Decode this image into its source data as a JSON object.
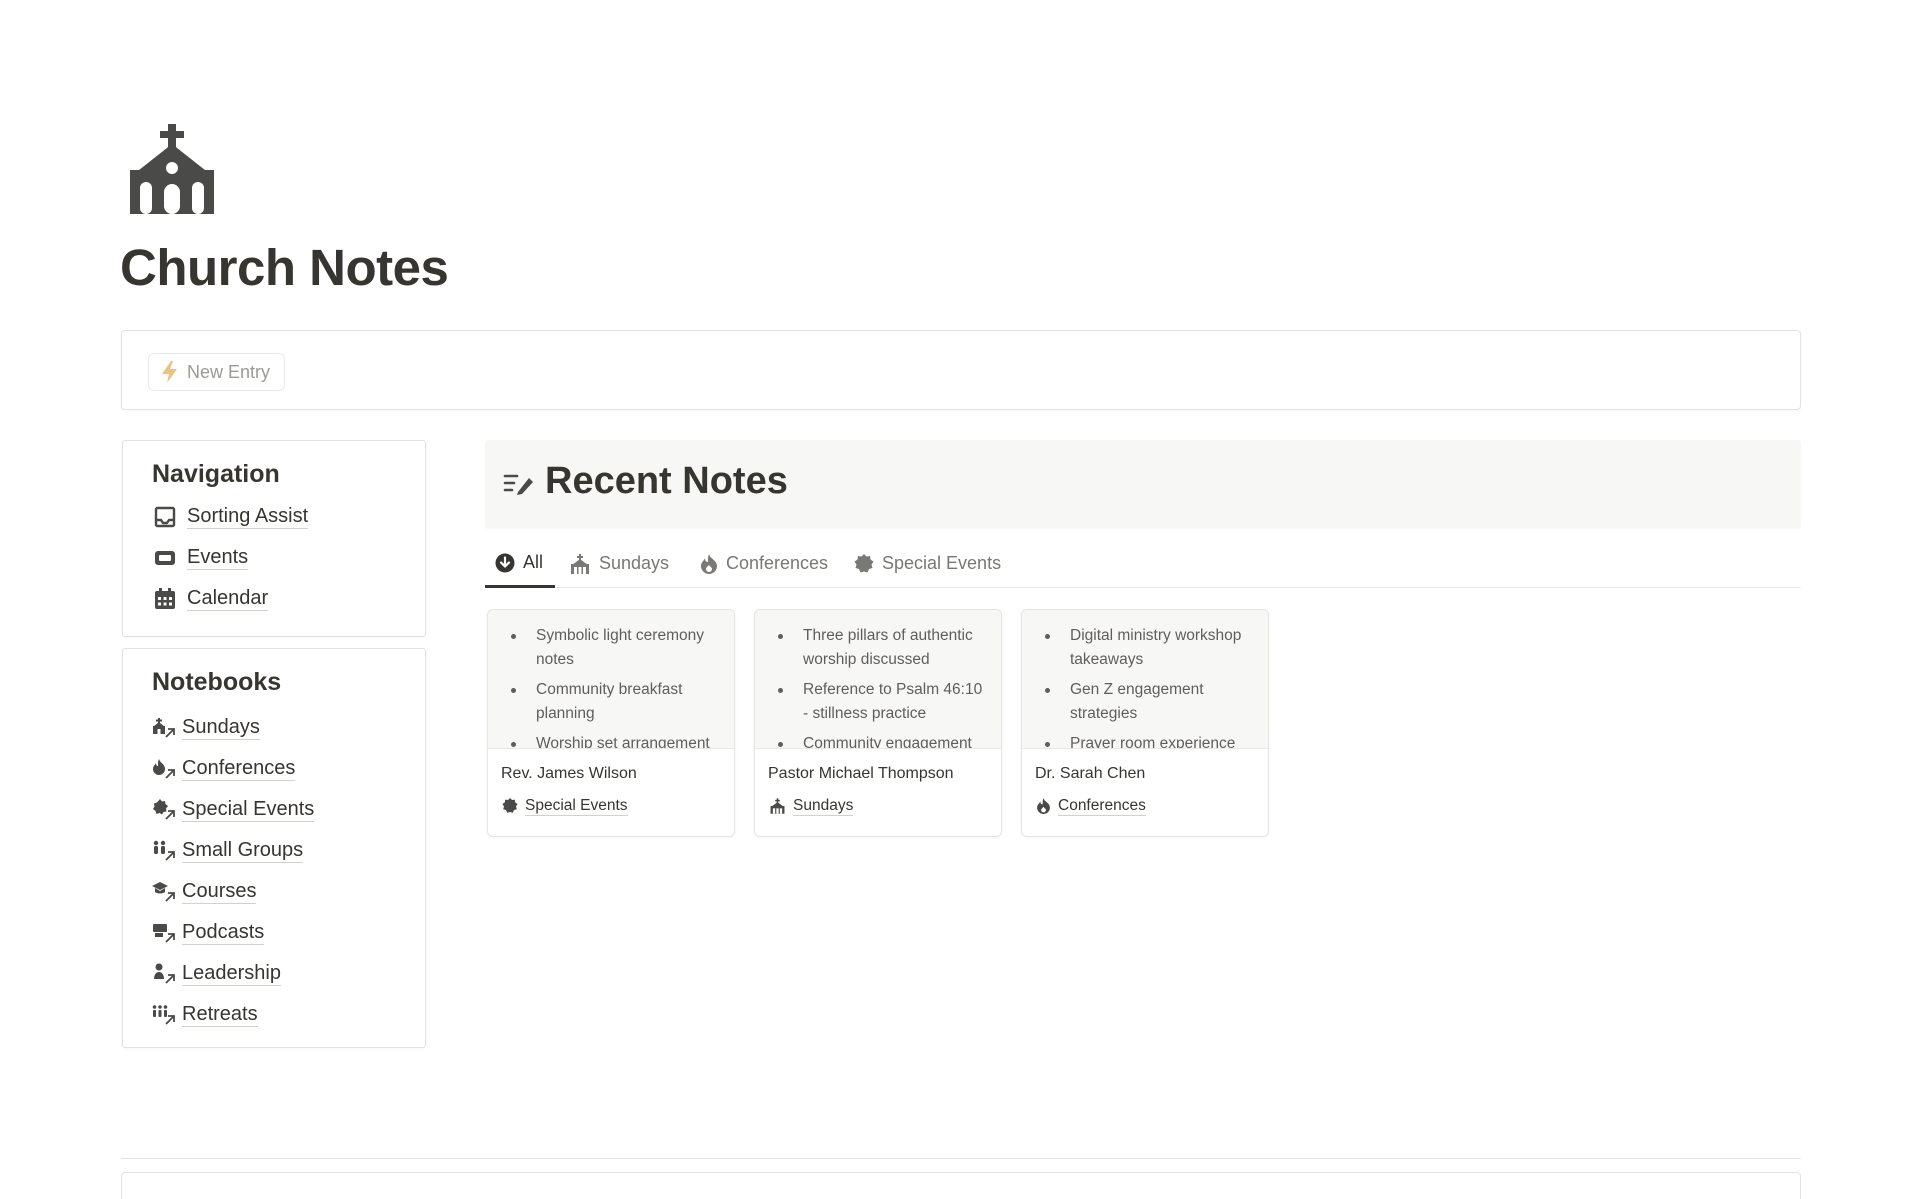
{
  "page": {
    "title": "Church Notes",
    "icon": "church-icon"
  },
  "entry_bar": {
    "new_entry_label": "New Entry",
    "icon": "lightning-icon"
  },
  "navigation": {
    "heading": "Navigation",
    "items": [
      {
        "label": "Sorting Assist",
        "icon": "inbox-icon"
      },
      {
        "label": "Events",
        "icon": "ticket-icon"
      },
      {
        "label": "Calendar",
        "icon": "calendar-icon"
      }
    ]
  },
  "notebooks": {
    "heading": "Notebooks",
    "items": [
      {
        "label": "Sundays",
        "icon": "church-link-icon"
      },
      {
        "label": "Conferences",
        "icon": "flame-link-icon"
      },
      {
        "label": "Special Events",
        "icon": "badge-link-icon"
      },
      {
        "label": "Small Groups",
        "icon": "people-link-icon"
      },
      {
        "label": "Courses",
        "icon": "graduation-link-icon"
      },
      {
        "label": "Podcasts",
        "icon": "microphone-link-icon"
      },
      {
        "label": "Leadership",
        "icon": "person-link-icon"
      },
      {
        "label": "Retreats",
        "icon": "group-link-icon"
      }
    ]
  },
  "recent_notes": {
    "heading": "Recent Notes",
    "tabs": [
      {
        "label": "All",
        "icon": "arrow-down-circle-icon",
        "active": true
      },
      {
        "label": "Sundays",
        "icon": "church-icon",
        "active": false
      },
      {
        "label": "Conferences",
        "icon": "flame-icon",
        "active": false
      },
      {
        "label": "Special Events",
        "icon": "badge-icon",
        "active": false
      }
    ],
    "cards": [
      {
        "bullets": [
          "Symbolic light ceremony notes",
          "Community breakfast planning",
          "Worship set arrangement"
        ],
        "author": "Rev. James Wilson",
        "tag": "Special Events",
        "tag_icon": "badge-icon"
      },
      {
        "bullets": [
          "Three pillars of authentic worship discussed",
          "Reference to Psalm 46:10 - stillness practice",
          "Community engagement"
        ],
        "author": "Pastor Michael Thompson",
        "tag": "Sundays",
        "tag_icon": "church-icon"
      },
      {
        "bullets": [
          "Digital ministry workshop takeaways",
          "Gen Z engagement strategies",
          "Prayer room experience"
        ],
        "author": "Dr. Sarah Chen",
        "tag": "Conferences",
        "tag_icon": "flame-icon"
      }
    ]
  },
  "colors": {
    "text": "#37352f",
    "muted": "#787774",
    "icon": "#4a4a48",
    "header_bg": "#f7f7f5",
    "accent_lightning": "#e8c382"
  }
}
